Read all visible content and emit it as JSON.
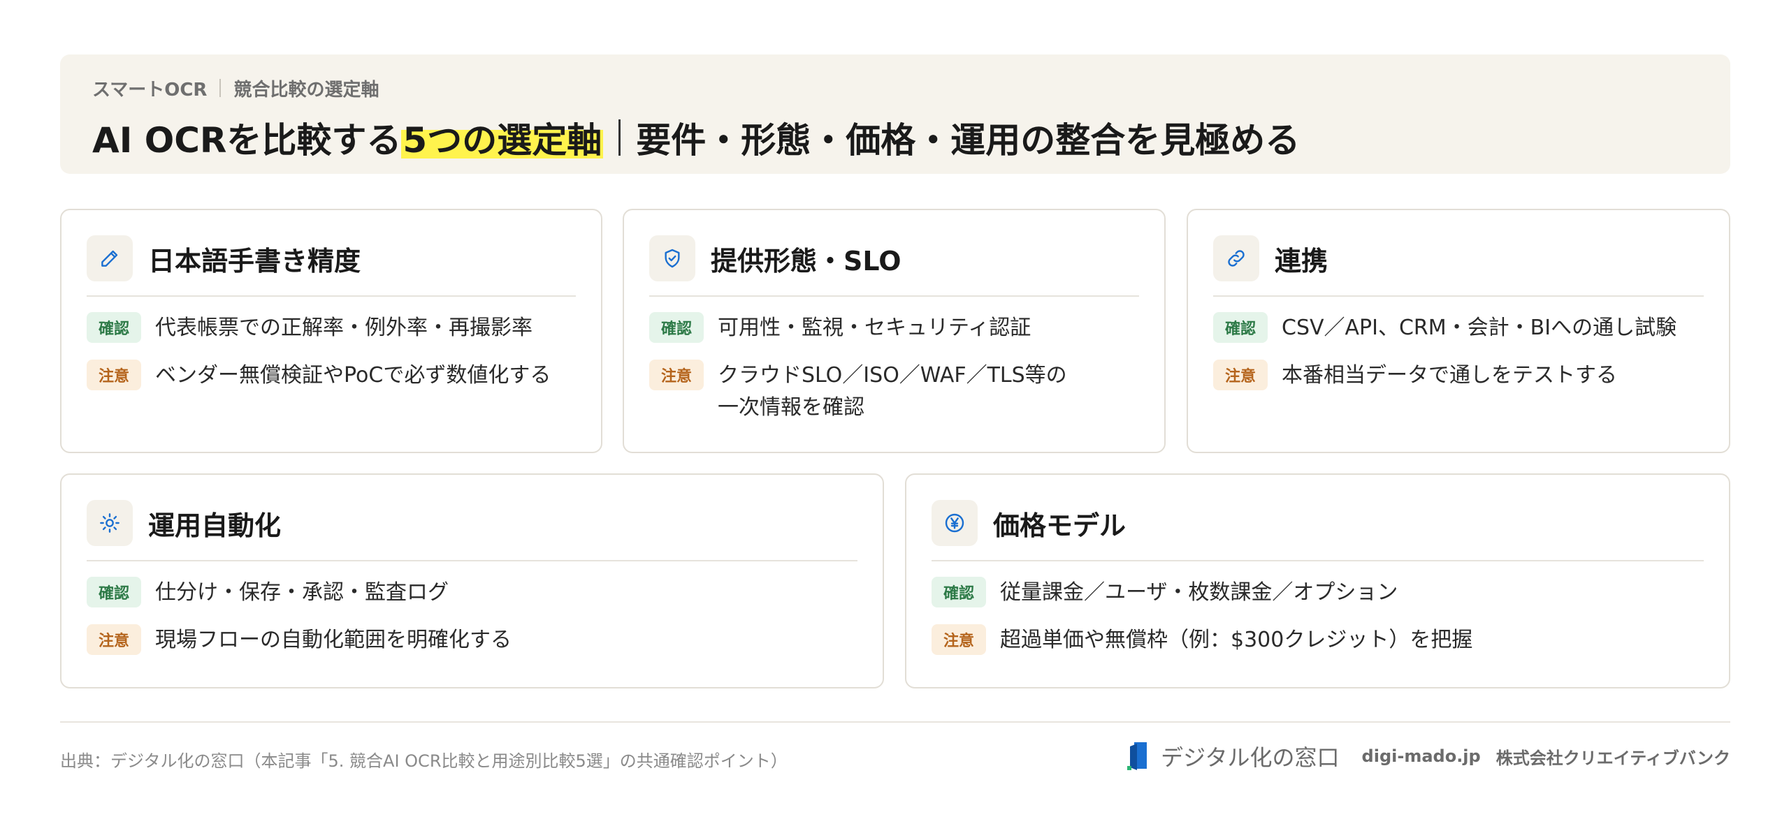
{
  "header": {
    "breadcrumb": {
      "brand": "スマートOCR",
      "section": "競合比較の選定軸"
    },
    "title": {
      "prefix": "AI OCRを比較する",
      "highlight": "5つの選定軸",
      "suffix": "要件・形態・価格・運用の整合を見極める"
    }
  },
  "badges": {
    "check": "確認",
    "caution": "注意"
  },
  "cards": [
    {
      "title": "日本語手書き精度",
      "icon": "pencil-icon",
      "check": "代表帳票での正解率・例外率・再撮影率",
      "caution": "ベンダー無償検証やPoCで必ず数値化する"
    },
    {
      "title": "提供形態・SLO",
      "icon": "shield-check-icon",
      "check": "可用性・監視・セキュリティ認証",
      "caution": "クラウドSLO／ISO／WAF／TLS等の\n一次情報を確認"
    },
    {
      "title": "連携",
      "icon": "link-icon",
      "check": "CSV／API、CRM・会計・BIへの通し試験",
      "caution": "本番相当データで通しをテストする"
    },
    {
      "title": "運用自動化",
      "icon": "sun-gear-icon",
      "check": "仕分け・保存・承認・監査ログ",
      "caution": "現場フローの自動化範囲を明確化する"
    },
    {
      "title": "価格モデル",
      "icon": "yen-icon",
      "check": "従量課金／ユーザ・枚数課金／オプション",
      "caution": "超過単価や無償枠（例：$300クレジット）を把握"
    }
  ],
  "footer": {
    "source": "出典：デジタル化の窓口（本記事「5. 競合AI OCR比較と用途別比較5選」の共通確認ポイント）",
    "logo_text": "デジタル化の窓口",
    "domain": "digi-mado.jp",
    "company": "株式会社クリエイティブバンク"
  },
  "colors": {
    "accent": "#1a6fd1",
    "highlight": "#fff34d",
    "check_bg": "#e5f4ea",
    "check_fg": "#2d7a47",
    "caution_bg": "#fbeedd",
    "caution_fg": "#b5651d"
  }
}
